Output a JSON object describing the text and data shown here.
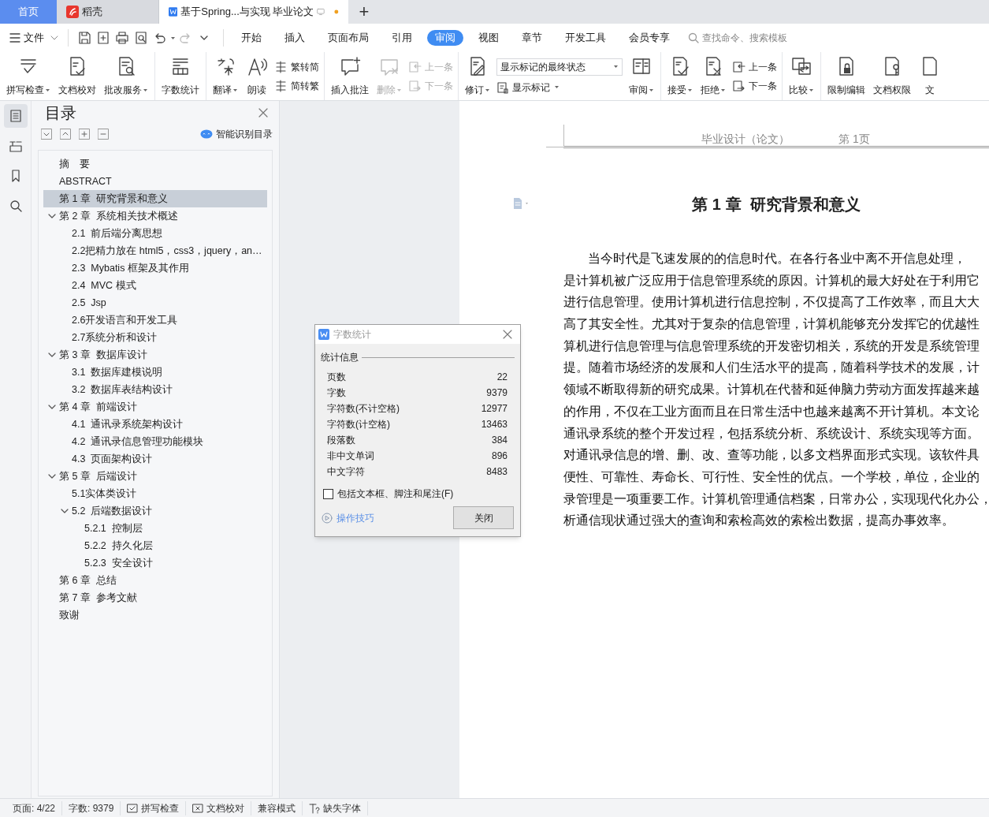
{
  "tabs": [
    {
      "kind": "home",
      "label": "首页",
      "selected": false
    },
    {
      "kind": "app",
      "label": "稻壳",
      "selected": false
    },
    {
      "kind": "document",
      "label": "基于Spring...与实现 毕业论文",
      "selected": true,
      "unsaved": true
    }
  ],
  "new_tab": "+",
  "file_menu": "文件",
  "menu_tabs": [
    {
      "label": "开始",
      "selected": false
    },
    {
      "label": "插入",
      "selected": false
    },
    {
      "label": "页面布局",
      "selected": false
    },
    {
      "label": "引用",
      "selected": false
    },
    {
      "label": "审阅",
      "selected": true
    },
    {
      "label": "视图",
      "selected": false
    },
    {
      "label": "章节",
      "selected": false
    },
    {
      "label": "开发工具",
      "selected": false
    },
    {
      "label": "会员专享",
      "selected": false
    }
  ],
  "search": {
    "placeholder": "查找命令、搜索模板"
  },
  "ribbon_groups": [
    {
      "items": [
        {
          "kind": "large",
          "label": "拼写检查",
          "dropdown": true,
          "disabled": false
        },
        {
          "kind": "large",
          "label": "文档校对",
          "dropdown": false,
          "disabled": false
        },
        {
          "kind": "large",
          "label": "批改服务",
          "dropdown": true,
          "disabled": false
        }
      ]
    },
    {
      "items": [
        {
          "kind": "large",
          "label": "字数统计",
          "dropdown": false,
          "disabled": false
        }
      ]
    },
    {
      "items": [
        {
          "kind": "large",
          "label": "翻译",
          "dropdown": true,
          "disabled": false
        },
        {
          "kind": "large",
          "label": "朗读",
          "dropdown": false,
          "disabled": false
        },
        {
          "kind": "stack",
          "buttons": [
            {
              "label": "繁转简",
              "disabled": false
            },
            {
              "label": "简转繁",
              "disabled": false
            }
          ]
        }
      ]
    },
    {
      "items": [
        {
          "kind": "large",
          "label": "插入批注",
          "dropdown": false,
          "disabled": false
        },
        {
          "kind": "large",
          "label": "删除",
          "dropdown": true,
          "disabled": true
        },
        {
          "kind": "stack",
          "buttons": [
            {
              "label": "上一条",
              "disabled": true
            },
            {
              "label": "下一条",
              "disabled": true
            }
          ]
        }
      ]
    },
    {
      "items": [
        {
          "kind": "large",
          "label": "修订",
          "dropdown": true,
          "disabled": false
        },
        {
          "kind": "select",
          "value": "显示标记的最终状态",
          "button": {
            "label": "显示标记",
            "dropdown": true
          }
        },
        {
          "kind": "large",
          "label": "审阅",
          "dropdown": true,
          "disabled": false
        }
      ]
    },
    {
      "items": [
        {
          "kind": "large",
          "label": "接受",
          "dropdown": true,
          "disabled": false
        },
        {
          "kind": "large",
          "label": "拒绝",
          "dropdown": true,
          "disabled": false
        },
        {
          "kind": "stack",
          "buttons": [
            {
              "label": "上一条",
              "disabled": false
            },
            {
              "label": "下一条",
              "disabled": false
            }
          ]
        }
      ]
    },
    {
      "items": [
        {
          "kind": "large",
          "label": "比较",
          "dropdown": true,
          "disabled": false
        }
      ]
    },
    {
      "items": [
        {
          "kind": "large",
          "label": "限制编辑",
          "dropdown": false,
          "disabled": false
        },
        {
          "kind": "large",
          "label": "文档权限",
          "dropdown": false,
          "disabled": false
        },
        {
          "kind": "large",
          "label": "文",
          "dropdown": false,
          "disabled": false
        }
      ]
    }
  ],
  "toc": {
    "title": "目录",
    "smart_button": "智能识别目录",
    "items": [
      {
        "label": "摘　要",
        "selected": false
      },
      {
        "label": "ABSTRACT",
        "selected": false
      },
      {
        "label": "第 1 章  研究背景和意义",
        "selected": true
      },
      {
        "label": "第 2 章  系统相关技术概述",
        "selected": false,
        "expanded": true,
        "children": [
          {
            "label": "2.1  前后端分离思想",
            "selected": false
          },
          {
            "label": "2.2把精力放在 html5，css3，jquery，an…",
            "selected": false
          },
          {
            "label": "2.3  Mybatis 框架及其作用",
            "selected": false
          },
          {
            "label": "2.4  MVC 模式",
            "selected": false
          },
          {
            "label": "2.5  Jsp",
            "selected": false
          },
          {
            "label": "2.6开发语言和开发工具",
            "selected": false
          },
          {
            "label": "2.7系统分析和设计",
            "selected": false
          }
        ]
      },
      {
        "label": "第 3 章  数据库设计",
        "selected": false,
        "expanded": true,
        "children": [
          {
            "label": "3.1  数据库建模说明",
            "selected": false
          },
          {
            "label": "3.2  数据库表结构设计",
            "selected": false
          }
        ]
      },
      {
        "label": "第 4 章  前端设计",
        "selected": false,
        "expanded": true,
        "children": [
          {
            "label": "4.1  通讯录系统架构设计",
            "selected": false
          },
          {
            "label": "4.2  通讯录信息管理功能模块",
            "selected": false
          },
          {
            "label": "4.3  页面架构设计",
            "selected": false
          }
        ]
      },
      {
        "label": "第 5 章  后端设计",
        "selected": false,
        "expanded": true,
        "children": [
          {
            "label": "5.1实体类设计",
            "selected": false
          },
          {
            "label": "5.2  后端数据设计",
            "selected": false,
            "expanded": true,
            "children": [
              {
                "label": "5.2.1  控制层",
                "selected": false
              },
              {
                "label": "5.2.2  持久化层",
                "selected": false
              },
              {
                "label": "5.2.3  安全设计",
                "selected": false
              }
            ]
          }
        ]
      },
      {
        "label": "第 6 章  总结",
        "selected": false
      },
      {
        "label": "第 7 章  参考文献",
        "selected": false
      },
      {
        "label": "致谢",
        "selected": false
      }
    ]
  },
  "dialog": {
    "title": "字数统计",
    "section": "统计信息",
    "stats": [
      {
        "label": "页数",
        "value": "22"
      },
      {
        "label": "字数",
        "value": "9379"
      },
      {
        "label": "字符数(不计空格)",
        "value": "12977"
      },
      {
        "label": "字符数(计空格)",
        "value": "13463"
      },
      {
        "label": "段落数",
        "value": "384"
      },
      {
        "label": "非中文单词",
        "value": "896"
      },
      {
        "label": "中文字符",
        "value": "8483"
      }
    ],
    "checkbox": {
      "label": "包括文本框、脚注和尾注(F)",
      "checked": false
    },
    "help_link": "操作技巧",
    "close_button": "关闭"
  },
  "document": {
    "header_left": "毕业设计（论文）",
    "header_right": "第 1页",
    "heading": "第 1 章  研究背景和意义",
    "lines": [
      "当今时代是飞速发展的的信息时代。在各行各业中离不开信息处理，",
      "是计算机被广泛应用于信息管理系统的原因。计算机的最大好处在于利用它",
      "进行信息管理。使用计算机进行信息控制，不仅提高了工作效率，而且大大",
      "高了其安全性。尤其对于复杂的信息管理，计算机能够充分发挥它的优越性",
      "算机进行信息管理与信息管理系统的开发密切相关，系统的开发是系统管理",
      "提。随着市场经济的发展和人们生活水平的提高，随着科学技术的发展，计",
      "领域不断取得新的研究成果。计算机在代替和延伸脑力劳动方面发挥越来越",
      "的作用，不仅在工业方面而且在日常生活中也越来越离不开计算机。本文论",
      "通讯录系统的整个开发过程，包括系统分析、系统设计、系统实现等方面。",
      "对通讯录信息的增、删、改、查等功能，以多文档界面形式实现。该软件具",
      "便性、可靠性、寿命长、可行性、安全性的优点。一个学校，单位，企业的",
      "录管理是一项重要工作。计算机管理通信档案，日常办公，实现现代化办公，",
      "析通信现状通过强大的查询和索检高效的索检出数据，提高办事效率。"
    ]
  },
  "status_bar": [
    {
      "kind": "text",
      "label": "页面: 4/22"
    },
    {
      "kind": "text",
      "label": "字数: 9379"
    },
    {
      "kind": "spell",
      "label": "拼写检查"
    },
    {
      "kind": "proof",
      "label": "文档校对"
    },
    {
      "kind": "text",
      "label": "兼容模式"
    },
    {
      "kind": "font",
      "label": "缺失字体"
    }
  ]
}
